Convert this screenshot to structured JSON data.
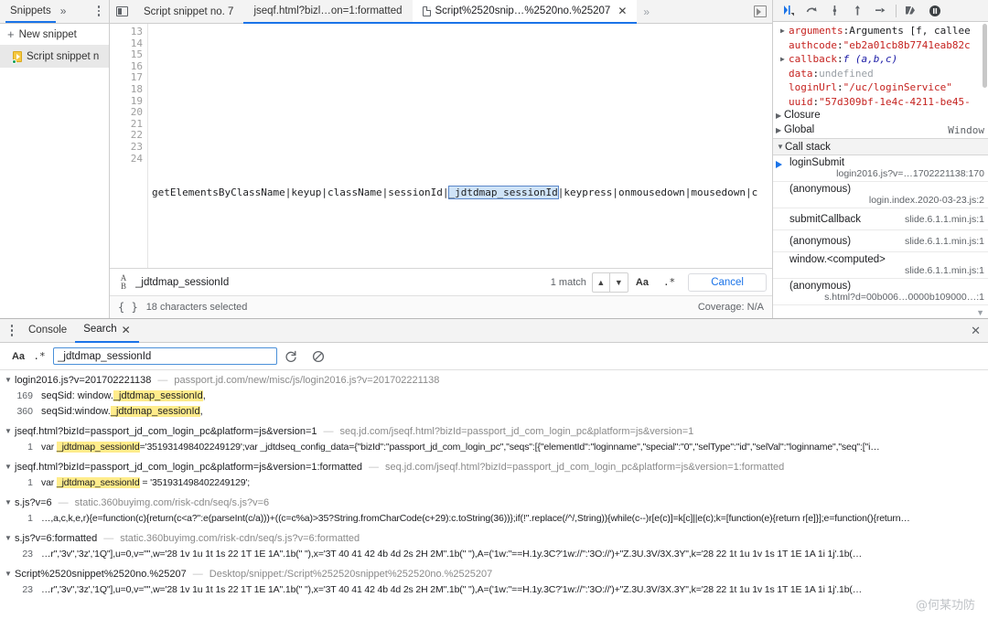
{
  "navigator": {
    "tab_label": "Snippets",
    "more_label": "»",
    "new_snippet_label": "New snippet",
    "snippet_item": "Script snippet n"
  },
  "editor": {
    "tabs": [
      {
        "label": "Script snippet no. 7",
        "active": false,
        "closable": false
      },
      {
        "label": "jseqf.html?bizl…on=1:formatted",
        "active": false,
        "closable": false
      },
      {
        "label": "Script%2520snip…%2520no.%25207",
        "active": true,
        "closable": true
      }
    ],
    "overflow_label": "»",
    "gutter_lines": [
      "13",
      "14",
      "15",
      "16",
      "17",
      "18",
      "19",
      "20",
      "21",
      "22",
      "23",
      "24"
    ],
    "code_line_23_before": "getElementsByClassName|keyup|className|sessionId|",
    "code_line_23_selection": "_jdtdmap_sessionId",
    "code_line_23_after": "|keypress|onmousedown|mousedown|c",
    "find": {
      "value": "_jdtdmap_sessionId",
      "match_count": "1 match",
      "prev_label": "▲",
      "next_label": "▼",
      "match_case_label": "Aa",
      "regex_label": ".*",
      "cancel_label": "Cancel"
    },
    "status": {
      "braces_label": "{ }",
      "selection_text": "18 characters selected",
      "coverage_text": "Coverage: N/A"
    }
  },
  "debugger": {
    "toolbar_icons": [
      "resume-icon",
      "step-over-icon",
      "step-into-icon",
      "step-out-icon",
      "step-icon",
      "deactivate-breakpoints-icon",
      "pause-on-exceptions-icon"
    ],
    "scope_rows": [
      {
        "expandable": true,
        "name": "arguments",
        "sep": ": ",
        "value": "Arguments [f, callee",
        "value_type": "plain"
      },
      {
        "expandable": false,
        "name": "authcode",
        "sep": ": ",
        "value": "\"eb2a01cb8b7741eab82c",
        "value_type": "string"
      },
      {
        "expandable": true,
        "name": "callback",
        "sep": ": ",
        "value": "f (a,b,c)",
        "value_type": "fn"
      },
      {
        "expandable": false,
        "name": "data",
        "sep": ": ",
        "value": "undefined",
        "value_type": "undef"
      },
      {
        "expandable": false,
        "name": "loginUrl",
        "sep": ": ",
        "value": "\"/uc/loginService\"",
        "value_type": "string"
      },
      {
        "expandable": false,
        "name": "uuid",
        "sep": ": ",
        "value": "\"57d309bf-1e4c-4211-be45-",
        "value_type": "string"
      }
    ],
    "scope_groups": [
      {
        "label": "Closure",
        "right": ""
      },
      {
        "label": "Global",
        "right": "Window"
      }
    ],
    "call_stack": {
      "title": "Call stack",
      "frames": [
        {
          "name": "loginSubmit",
          "location": "login2016.js?v=…1702221138:170",
          "selected": true,
          "wrap": true
        },
        {
          "name": "(anonymous)",
          "location": "login.index.2020-03-23.js:2",
          "selected": false,
          "wrap": true
        },
        {
          "name": "submitCallback",
          "location": "slide.6.1.1.min.js:1",
          "selected": false,
          "wrap": false
        },
        {
          "name": "(anonymous)",
          "location": "slide.6.1.1.min.js:1",
          "selected": false,
          "wrap": false
        },
        {
          "name": "window.<computed>",
          "location": "slide.6.1.1.min.js:1",
          "selected": false,
          "wrap": true
        },
        {
          "name": "(anonymous)",
          "location": "s.html?d=00b006…0000b109000…:1",
          "selected": false,
          "wrap": true
        }
      ]
    }
  },
  "drawer": {
    "tabs": [
      {
        "label": "Console",
        "active": false,
        "closable": false
      },
      {
        "label": "Search",
        "active": true,
        "closable": true
      }
    ],
    "close_label": "✕",
    "search": {
      "match_case_label": "Aa",
      "regex_label": ".*",
      "value": "_jdtdmap_sessionId",
      "refresh_icon": "refresh-icon",
      "clear_icon": "clear-icon"
    },
    "results": [
      {
        "file": "login2016.js?v=201702221138",
        "url": "passport.jd.com/new/misc/js/login2016.js?v=201702221138",
        "lines": [
          {
            "no": "169",
            "before": "seqSid: window.",
            "match": "_jdtdmap_sessionId",
            "after": ","
          },
          {
            "no": "360",
            "before": "seqSid:window.",
            "match": "_jdtdmap_sessionId",
            "after": ","
          }
        ]
      },
      {
        "file": "jseqf.html?bizId=passport_jd_com_login_pc&platform=js&version=1",
        "url": "seq.jd.com/jseqf.html?bizId=passport_jd_com_login_pc&platform=js&version=1",
        "lines": [
          {
            "no": "1",
            "before": "var ",
            "match": "_jdtdmap_sessionId",
            "after": "='351931498402249129';var _jdtdseq_config_data={\"bizId\":\"passport_jd_com_login_pc\",\"seqs\":[{\"elementId\":\"loginname\",\"special\":\"0\",\"selType\":\"id\",\"selVal\":\"loginname\",\"seq\":[\"i…"
          }
        ]
      },
      {
        "file": "jseqf.html?bizId=passport_jd_com_login_pc&platform=js&version=1:formatted",
        "url": "seq.jd.com/jseqf.html?bizId=passport_jd_com_login_pc&platform=js&version=1:formatted",
        "lines": [
          {
            "no": "1",
            "before": "var ",
            "match": "_jdtdmap_sessionId",
            "after": " = '351931498402249129';"
          }
        ]
      },
      {
        "file": "s.js?v=6",
        "url": "static.360buyimg.com/risk-cdn/seq/s.js?v=6",
        "lines": [
          {
            "no": "1",
            "before": "",
            "match": "",
            "after": "…,a,c,k,e,r){e=function(c){return(c<a?'':e(parseInt(c/a)))+((c=c%a)>35?String.fromCharCode(c+29):c.toString(36))};if(!''.replace(/^/,String)){while(c--)r[e(c)]=k[c]||e(c);k=[function(e){return r[e]}];e=function(){return…"
          }
        ]
      },
      {
        "file": "s.js?v=6:formatted",
        "url": "static.360buyimg.com/risk-cdn/seq/s.js?v=6:formatted",
        "lines": [
          {
            "no": "23",
            "before": "",
            "match": "",
            "after": "…r\",'3v\",'3z','1Q\"],u=0,v=\"\",w='28 1v 1u 1t 1s 22 1T 1E 1A\".1b(\" \"),x='3T 40 41 42 4b 4d 2s 2H 2M\".1b(\" \"),A=('1w:\"==H.1y.3C?'1w://\":'3O://')+\"Z.3U.3V/3X.3Y\",k='28 22 1t 1u 1v 1s 1T 1E 1A 1i 1j'.1b(…"
          }
        ]
      },
      {
        "file": "Script%2520snippet%2520no.%25207",
        "url": "Desktop/snippet:/Script%252520snippet%252520no.%2525207",
        "lines": [
          {
            "no": "23",
            "before": "",
            "match": "",
            "after": "…r\",'3v\",'3z','1Q\"],u=0,v=\"\",w='28 1v 1u 1t 1s 22 1T 1E 1A\".1b(\" \"),x='3T 40 41 42 4b 4d 2s 2H 2M\".1b(\" \"),A=('1w:\"==H.1y.3C?'1w://\":'3O://')+\"Z.3U.3V/3X.3Y\",k='28 22 1t 1u 1v 1s 1T 1E 1A 1i 1j'.1b(…"
          }
        ]
      }
    ]
  },
  "watermark": "@何某功防"
}
